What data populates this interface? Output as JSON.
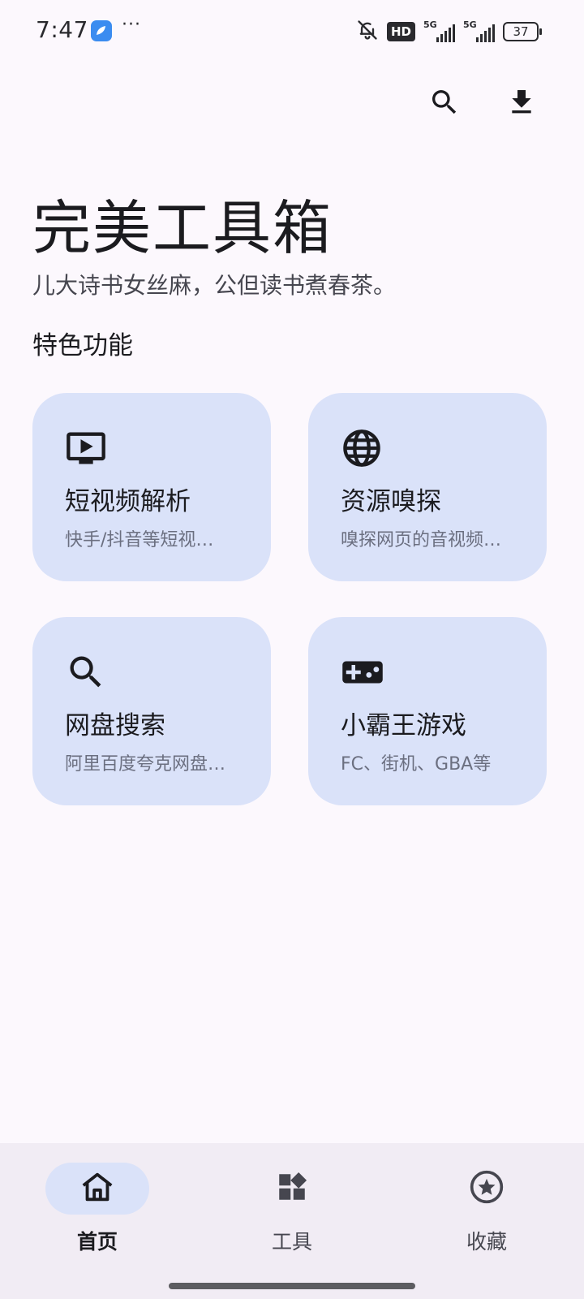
{
  "status_bar": {
    "time": "7:47",
    "dots": "···",
    "hd_badge": "HD",
    "signal_1_label": "5G",
    "signal_2_label": "5G",
    "battery": "37",
    "icons": [
      "app-icon",
      "bell-off-icon",
      "hd-icon",
      "signal-icon",
      "battery-icon"
    ]
  },
  "app_bar": {
    "actions": [
      "search-icon",
      "download-icon"
    ]
  },
  "header": {
    "title": "完美工具箱",
    "subtitle": "儿大诗书女丝麻，公但读书煮春茶。"
  },
  "section": {
    "title": "特色功能"
  },
  "features": [
    {
      "icon": "tv-play-icon",
      "title": "短视频解析",
      "desc": "快手/抖音等短视…"
    },
    {
      "icon": "globe-icon",
      "title": "资源嗅探",
      "desc": "嗅探网页的音视频…"
    },
    {
      "icon": "search-icon",
      "title": "网盘搜索",
      "desc": "阿里百度夸克网盘…"
    },
    {
      "icon": "gamepad-icon",
      "title": "小霸王游戏",
      "desc": "FC、街机、GBA等"
    }
  ],
  "colors": {
    "background": "#fcf8fd",
    "card": "#dae2f9",
    "nav_background": "#f1ecf4",
    "nav_active_indicator": "#dae2f9",
    "text_primary": "#1b1b1f",
    "text_secondary": "#6b6f80"
  },
  "bottom_nav": {
    "items": [
      {
        "icon": "home-icon",
        "label": "首页",
        "active": true
      },
      {
        "icon": "widgets-icon",
        "label": "工具",
        "active": false
      },
      {
        "icon": "star-circle-icon",
        "label": "收藏",
        "active": false
      }
    ]
  }
}
